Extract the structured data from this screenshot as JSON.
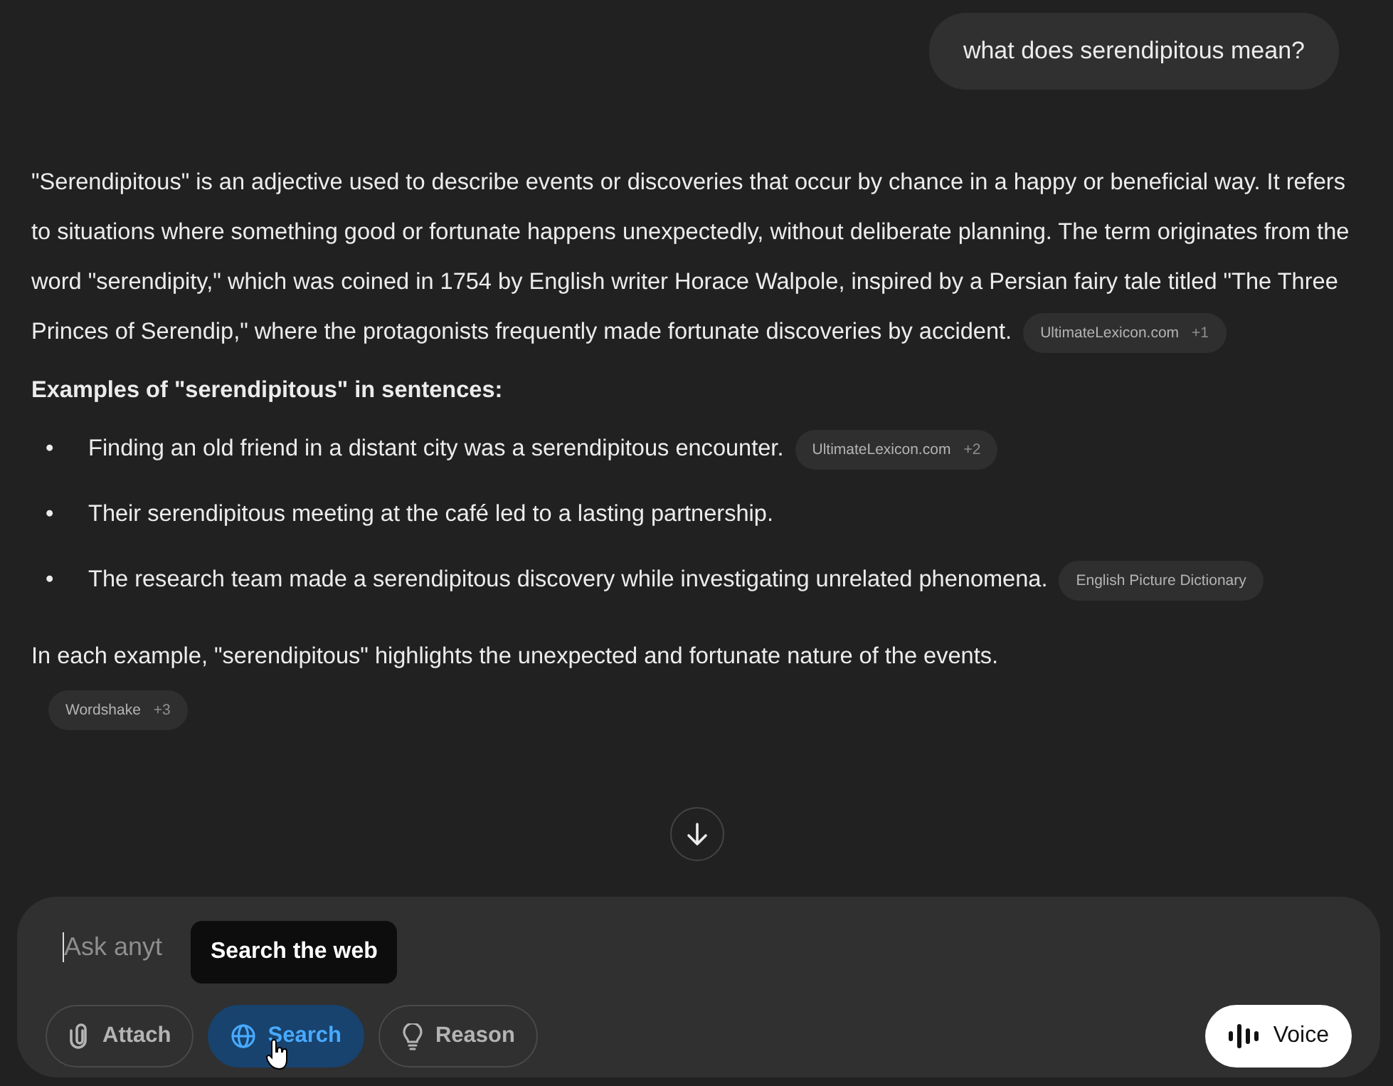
{
  "user_message": "what does serendipitous mean?",
  "answer": {
    "intro": {
      "text": "\"Serendipitous\" is an adjective used to describe events or discoveries that occur by chance in a happy or beneficial way. It refers to situations where something good or fortunate happens unexpectedly, without deliberate planning. The term originates from the word \"serendipity,\" which was coined in 1754 by English writer Horace Walpole, inspired by a Persian fairy tale titled \"The Three Princes of Serendip,\" where the protagonists frequently made fortunate discoveries by accident.",
      "source": {
        "name": "UltimateLexicon.com",
        "count": "+1"
      }
    },
    "heading": "Examples of \"serendipitous\" in sentences:",
    "bullets": [
      {
        "marker": "•",
        "text": "Finding an old friend in a distant city was a serendipitous encounter.",
        "source": {
          "name": "UltimateLexicon.com",
          "count": "+2"
        }
      },
      {
        "marker": "•",
        "text": "Their serendipitous meeting at the café led to a lasting partnership."
      },
      {
        "marker": "•",
        "text": "The research team made a serendipitous discovery while investigating unrelated phenomena.",
        "source": {
          "name": "English Picture Dictionary"
        }
      }
    ],
    "outro": {
      "text": "In each example, \"serendipitous\" highlights the unexpected and fortunate nature of the events.",
      "source": {
        "name": "Wordshake",
        "count": "+3"
      }
    }
  },
  "composer": {
    "placeholder": "Ask anyt",
    "tooltip": "Search the web",
    "tools": [
      {
        "label": "Attach",
        "selected": false
      },
      {
        "label": "Search",
        "selected": true
      },
      {
        "label": "Reason",
        "selected": false
      }
    ],
    "voice": "Voice"
  }
}
